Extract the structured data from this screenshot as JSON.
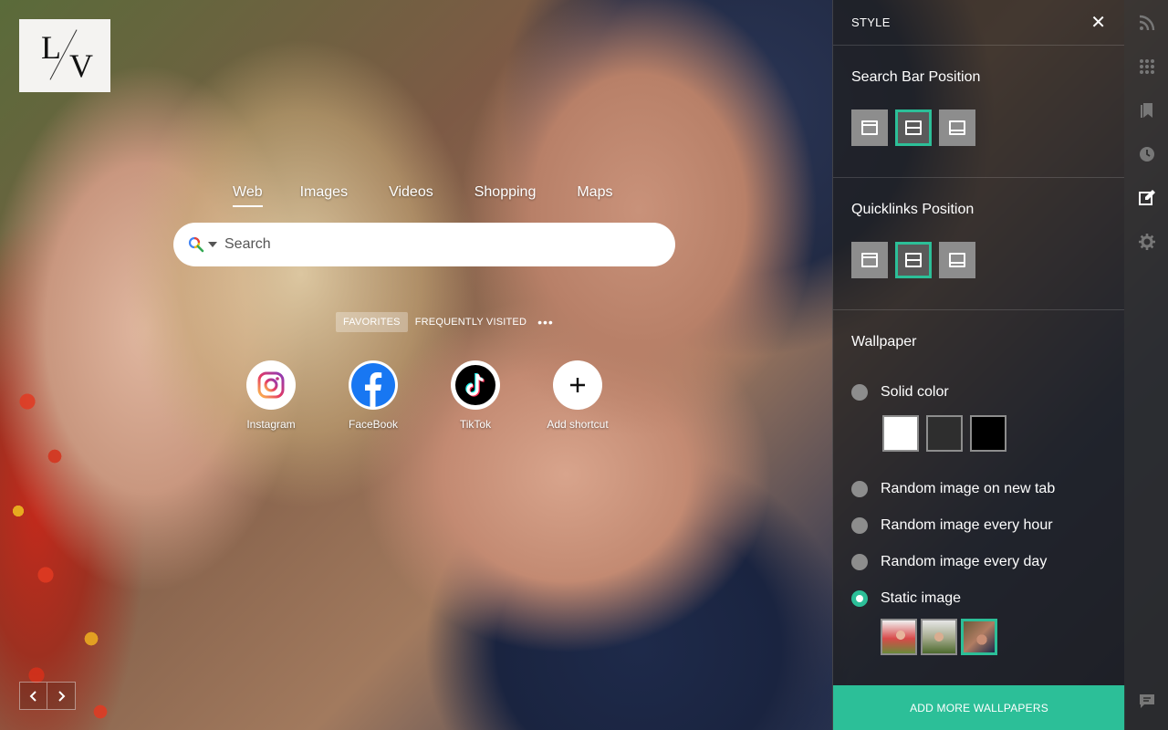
{
  "logo": {
    "letter1": "L",
    "letter2": "V"
  },
  "search": {
    "tabs": [
      {
        "label": "Web",
        "active": true
      },
      {
        "label": "Images",
        "active": false
      },
      {
        "label": "Videos",
        "active": false
      },
      {
        "label": "Shopping",
        "active": false
      },
      {
        "label": "Maps",
        "active": false
      }
    ],
    "placeholder": "Search",
    "engine_icon": "search-icon"
  },
  "quicklinks": {
    "tabs": [
      {
        "label": "FAVORITES",
        "active": true
      },
      {
        "label": "FREQUENTLY VISITED",
        "active": false
      }
    ],
    "more": "•••",
    "shortcuts": [
      {
        "label": "Instagram",
        "icon": "instagram-icon"
      },
      {
        "label": "FaceBook",
        "icon": "facebook-icon"
      },
      {
        "label": "TikTok",
        "icon": "tiktok-icon"
      },
      {
        "label": "Add shortcut",
        "icon": "plus-icon"
      }
    ]
  },
  "panel": {
    "title": "STYLE",
    "close": "✕",
    "search_bar_position": {
      "title": "Search Bar Position",
      "selected": "middle"
    },
    "quicklinks_position": {
      "title": "Quicklinks Position",
      "selected": "middle"
    },
    "wallpaper": {
      "title": "Wallpaper",
      "options": [
        {
          "label": "Solid color",
          "checked": false
        },
        {
          "label": "Random image on new tab",
          "checked": false
        },
        {
          "label": "Random image every hour",
          "checked": false
        },
        {
          "label": "Random image every day",
          "checked": false
        },
        {
          "label": "Static image",
          "checked": true
        }
      ],
      "solid_colors": [
        "#ffffff",
        "#2e2e2e",
        "#000000"
      ]
    },
    "add_button": "ADD MORE WALLPAPERS"
  },
  "colors": {
    "accent": "#2cbf98",
    "panel_bg": "#1e1e1e"
  },
  "rail": [
    "rss-icon",
    "apps-grid-icon",
    "bookmark-icon",
    "clock-icon",
    "edit-style-icon",
    "gear-icon",
    "feedback-icon"
  ]
}
